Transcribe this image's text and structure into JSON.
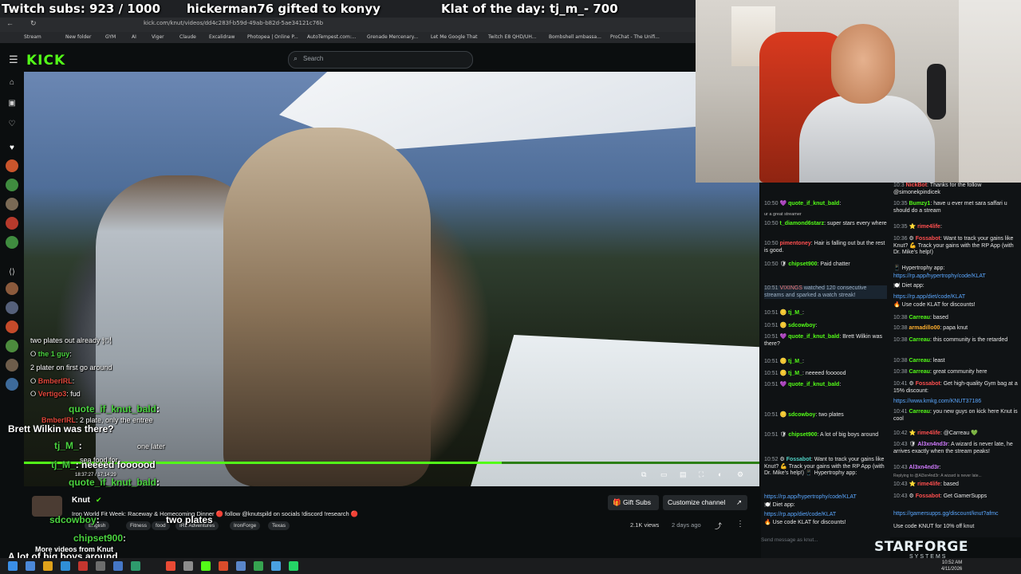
{
  "overlay": {
    "subs": "Twitch subs: 923 / 1000",
    "gift": "hickerman76 gifted to konyy",
    "klat": "Klat of the day: tj_m_- 700"
  },
  "browser": {
    "url": "kick.com/knut/videos/dd4c283f-b59d-49ab-b82d-5ae34121c76b",
    "bookmarks": [
      "Stream",
      "New folder",
      "GYM",
      "AI",
      "Viger",
      "Claude",
      "Excalidraw",
      "Photopea | Online P...",
      "AutoTempest.com:...",
      "Grenade Mercenary...",
      "Let Me Google That",
      "Twitch E8 QHD/UH...",
      "Bombshell ambassa...",
      "ProChat - The Unifi..."
    ]
  },
  "kick": {
    "logo": "KICK",
    "search_placeholder": "Search"
  },
  "video": {
    "channel_name": "Knut",
    "verified_icon": "✔",
    "title": "Iron World Fit Week: Raceway & Homecoming Dinner 🔴 follow @knutspild on socials !discord !research 🔴",
    "tags": [
      "English",
      "Fitness",
      "food",
      "IRL Adventures",
      "IronForge",
      "Texas"
    ],
    "gift_subs": "Gift Subs",
    "customize": "Customize channel",
    "views": "2.1K views",
    "date_ago": "2 days ago",
    "more_videos": "More videos from Knut",
    "progress": 0.65
  },
  "stream_chat_overlay": [
    {
      "name": "",
      "text": "two plates out already"
    },
    {
      "name": "the 1 guy",
      "text": ":"
    },
    {
      "name": "",
      "text": "2 plater on first go around"
    },
    {
      "name": "BmberIRL",
      "text": ":"
    },
    {
      "name": "Vertigo3",
      "text": ": fud"
    },
    {
      "name": "quote_if_knut_bald",
      "text": ":"
    },
    {
      "name": "BmberIRL",
      "text": ": 2 plate, only the entree"
    },
    {
      "name": "",
      "text": "Brett Wilkin was there?"
    },
    {
      "name": "tj_M_",
      "text": ":"
    },
    {
      "name": "",
      "text": "one later"
    },
    {
      "name": "",
      "text": "sea food for"
    },
    {
      "name": "tj_M_",
      "text": ": neeeed foooood"
    },
    {
      "name": "",
      "text": "18:37:27 / 17:14:29"
    },
    {
      "name": "quote_if_knut_bald",
      "text": ":"
    },
    {
      "name": "sdcowboy",
      "text": ":"
    },
    {
      "name": "",
      "text": "two plates"
    },
    {
      "name": "chipset900",
      "text": ":"
    },
    {
      "name": "",
      "text": "A lot of big boys around"
    }
  ],
  "chat1": {
    "input_placeholder": "Send message as knut...",
    "lines": [
      {
        "ts": "",
        "name": "",
        "text": "ur a great streamer"
      },
      {
        "ts": "10:50",
        "name": "quote_if_knut_bald",
        "text": ":"
      },
      {
        "ts": "10:50",
        "name": "t_diamond6starz",
        "text": ": super stars every where"
      },
      {
        "ts": "10:50",
        "name": "pimentoney",
        "text": ": Hair is falling out but the rest is good."
      },
      {
        "ts": "10:50",
        "name": "chipset900",
        "text": ": Paid chatter"
      },
      {
        "ts": "10:51",
        "name": "VIXINGS",
        "text": " watched 120 consecutive streams and sparked a watch streak!"
      },
      {
        "ts": "10:51",
        "name": "tj_M_",
        "text": ":"
      },
      {
        "ts": "10:51",
        "name": "sdcowboy",
        "text": ":"
      },
      {
        "ts": "10:51",
        "name": "quote_if_knut_bald",
        "text": ": Brett Wilkin was there?"
      },
      {
        "ts": "10:51",
        "name": "tj_M_",
        "text": ":"
      },
      {
        "ts": "10:51",
        "name": "tj_M_",
        "text": ": neeeed foooood"
      },
      {
        "ts": "10:51",
        "name": "quote_if_knut_bald",
        "text": ":"
      },
      {
        "ts": "10:51",
        "name": "sdcowboy",
        "text": ": two plates"
      },
      {
        "ts": "10:51",
        "name": "chipset900",
        "text": ": A lot of big boys around"
      },
      {
        "ts": "10:52",
        "name": "Fossabot",
        "text": ": Want to track your gains like Knut? 💪 Track your gains with the RP App (with Dr. Mike's help!) 📱 Hypertrophy app:"
      },
      {
        "ts": "",
        "name": "",
        "text": "https://rp.app/hypertrophy/code/KLAT"
      },
      {
        "ts": "",
        "name": "",
        "text": "🍽️ Diet app:"
      },
      {
        "ts": "",
        "name": "",
        "text": "https://rp.app/diet/code/KLAT"
      },
      {
        "ts": "",
        "name": "",
        "text": "🔥 Use code KLAT for discounts!"
      }
    ]
  },
  "chat2": {
    "lines": [
      {
        "ts": "10:3",
        "name": "NickBot",
        "text": ": Thanks for the follow @simonekpindicek"
      },
      {
        "ts": "10:35",
        "name": "Bumzy1",
        "text": ": have u ever met sara saffari u should do a stream"
      },
      {
        "ts": "10:35",
        "name": "rime4life",
        "text": ":"
      },
      {
        "ts": "10:36",
        "name": "Fossabot",
        "text": ": Want to track your gains like Knut? 💪 Track your gains with the RP App (with Dr. Mike's help!)"
      },
      {
        "ts": "",
        "name": "",
        "text": "📱 Hypertrophy app:"
      },
      {
        "ts": "",
        "name": "",
        "text": "https://rp.app/hypertrophy/code/KLAT"
      },
      {
        "ts": "",
        "name": "",
        "text": "🍽️ Diet app:"
      },
      {
        "ts": "",
        "name": "",
        "text": "https://rp.app/diet/code/KLAT"
      },
      {
        "ts": "",
        "name": "",
        "text": "🔥 Use code KLAT for discounts!"
      },
      {
        "ts": "10:38",
        "name": "Carreau",
        "text": ": based"
      },
      {
        "ts": "10:38",
        "name": "armadillo00",
        "text": ": papa knut"
      },
      {
        "ts": "10:38",
        "name": "Carreau",
        "text": ": this community is the retarded"
      },
      {
        "ts": "10:38",
        "name": "Carreau",
        "text": ": least"
      },
      {
        "ts": "10:38",
        "name": "Carreau",
        "text": ": great community here"
      },
      {
        "ts": "10:41",
        "name": "Fossabot",
        "text": ": Get high-quality Gym bag at a 15% discount:"
      },
      {
        "ts": "",
        "name": "",
        "text": "https://www.kmkg.com/KNUT37186"
      },
      {
        "ts": "10:41",
        "name": "Carreau",
        "text": ": you new guys on kick here Knut is cool"
      },
      {
        "ts": "10:42",
        "name": "rime4life",
        "text": ": @Carreau 💚"
      },
      {
        "ts": "10:43",
        "name": "Al3xn4nd3r",
        "text": ": A wizard is never late, he arrives exactly when the stream peaks!"
      },
      {
        "ts": "10:43",
        "name": "Al3xn4nd3r",
        "text": ":"
      },
      {
        "ts": "",
        "name": "",
        "text": "Replying to @Al3xn4nd3r: A wizard is never late..."
      },
      {
        "ts": "10:43",
        "name": "rime4life",
        "text": ": based"
      },
      {
        "ts": "10:43",
        "name": "Fossabot",
        "text": ": Get GamerSupps"
      },
      {
        "ts": "",
        "name": "",
        "text": "https://gamersupps.gg/discount/knut?afmc"
      },
      {
        "ts": "",
        "name": "",
        "text": "Use code KNUT for 10% off knut"
      }
    ]
  },
  "brand": {
    "name": "STARFORGE",
    "sub": "SYSTEMS"
  },
  "tray": {
    "time": "10:52 AM",
    "date": "4/11/2026"
  },
  "colors": {
    "kick_green": "#53fc18",
    "background": "#0b0e0f"
  }
}
